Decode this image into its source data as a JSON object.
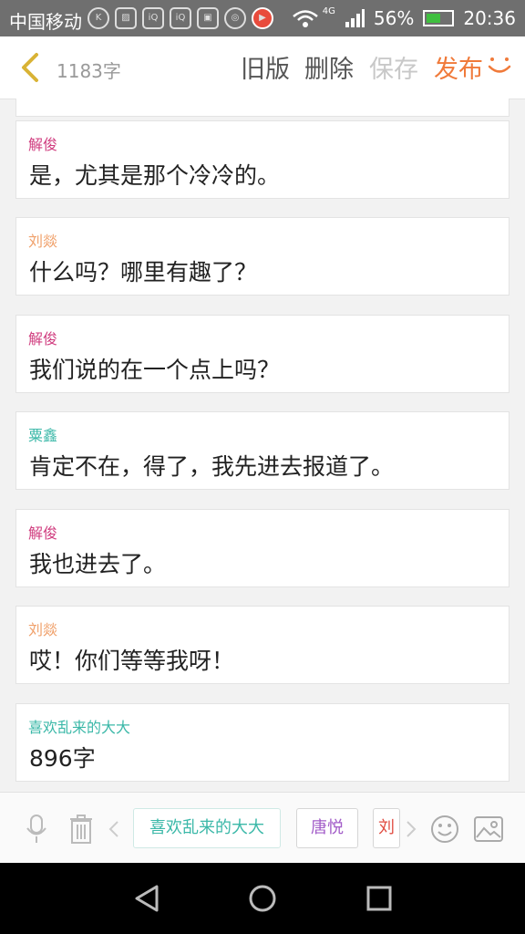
{
  "status_bar": {
    "carrier": "中国移动",
    "network": "4G",
    "battery": "56%",
    "battery_level": 0.56,
    "time": "20:36",
    "notification_icons": [
      "k-icon",
      "image-icon",
      "iqiyi-icon",
      "iqiyi-icon",
      "app-icon",
      "chat-icon",
      "video-icon"
    ]
  },
  "toolbar": {
    "word_count": "1183字",
    "old_version": "旧版",
    "delete": "删除",
    "save": "保存",
    "publish": "发布"
  },
  "colors": {
    "pink": "#d03d7f",
    "orange": "#f0a06a",
    "teal": "#3bb8a8",
    "purple": "#a25cc8",
    "red": "#e04b40",
    "publish": "#f07a3a"
  },
  "messages": [
    {
      "speaker": "解俊",
      "color": "#d03d7f",
      "text": "是，尤其是那个冷冷的。"
    },
    {
      "speaker": "刘燚",
      "color": "#f0a06a",
      "text": "什么吗？哪里有趣了？"
    },
    {
      "speaker": "解俊",
      "color": "#d03d7f",
      "text": "我们说的在一个点上吗？"
    },
    {
      "speaker": "粟鑫",
      "color": "#3bb8a8",
      "text": "肯定不在，得了，我先进去报道了。"
    },
    {
      "speaker": "解俊",
      "color": "#d03d7f",
      "text": "我也进去了。"
    },
    {
      "speaker": "刘燚",
      "color": "#f0a06a",
      "text": "哎！你们等等我呀！"
    },
    {
      "speaker": "喜欢乱来的大大",
      "color": "#3bb8a8",
      "text": "896字"
    }
  ],
  "role_chips": [
    {
      "label": "喜欢乱来的大大",
      "color": "#3bb8a8"
    },
    {
      "label": "唐悦",
      "color": "#a25cc8"
    },
    {
      "label": "刘",
      "color": "#e04b40"
    }
  ]
}
